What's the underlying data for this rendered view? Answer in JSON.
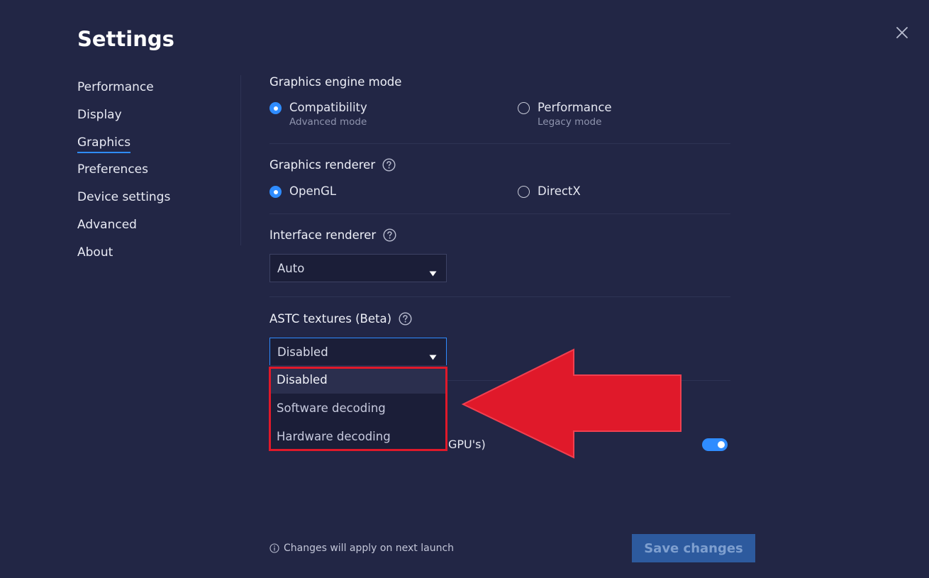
{
  "window": {
    "title": "Settings"
  },
  "sidebar": {
    "items": [
      {
        "label": "Performance",
        "active": false
      },
      {
        "label": "Display",
        "active": false
      },
      {
        "label": "Graphics",
        "active": true
      },
      {
        "label": "Preferences",
        "active": false
      },
      {
        "label": "Device settings",
        "active": false
      },
      {
        "label": "Advanced",
        "active": false
      },
      {
        "label": "About",
        "active": false
      }
    ]
  },
  "graphics_engine": {
    "label": "Graphics engine mode",
    "options": [
      {
        "label": "Compatibility",
        "sublabel": "Advanced mode",
        "checked": true
      },
      {
        "label": "Performance",
        "sublabel": "Legacy mode",
        "checked": false
      }
    ]
  },
  "graphics_renderer": {
    "label": "Graphics renderer",
    "options": [
      {
        "label": "OpenGL",
        "checked": true
      },
      {
        "label": "DirectX",
        "checked": false
      }
    ]
  },
  "interface_renderer": {
    "label": "Interface renderer",
    "value": "Auto"
  },
  "astc_textures": {
    "label": "ASTC textures (Beta)",
    "value": "Disabled",
    "options": [
      {
        "label": "Disabled",
        "selected": true
      },
      {
        "label": "Software decoding",
        "selected": false
      },
      {
        "label": "Hardware decoding",
        "selected": false
      }
    ]
  },
  "gpu_setting": {
    "partial_label": "GPU's)",
    "enabled": true
  },
  "footer": {
    "note": "Changes will apply on next launch",
    "save_label": "Save changes"
  },
  "colors": {
    "background": "#222645",
    "accent": "#2f8cff",
    "annotation_red": "#e0192a",
    "save_button": "#2d5a9e"
  },
  "icons": {
    "close": "close-icon",
    "help": "question-circle-icon",
    "caret": "caret-down-icon",
    "info": "info-circle-icon",
    "annotation": "red-arrow-left"
  }
}
